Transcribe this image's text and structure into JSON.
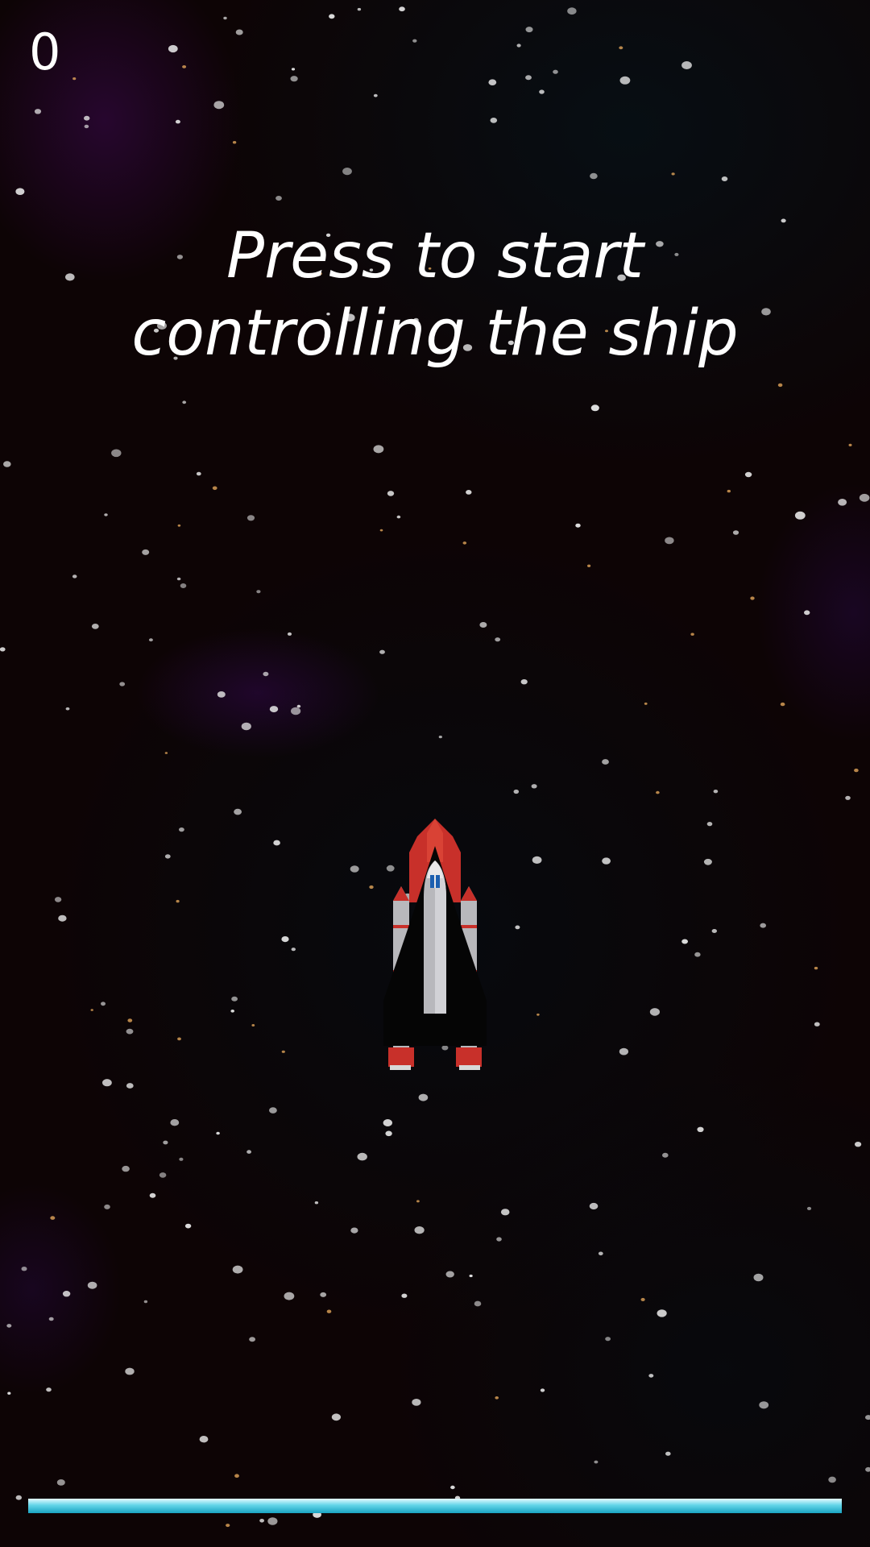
{
  "hud": {
    "score": "0"
  },
  "prompt": {
    "line1": "Press to start",
    "line2": "controlling the ship"
  },
  "progress": {
    "fill_fraction": 1.0,
    "color": "#2fb7d0"
  },
  "ship": {
    "icon": "space-shuttle-icon",
    "colors": {
      "body": "#b8b8bc",
      "accent": "#c8302a",
      "wings": "#050505",
      "window": "#1b5fb0"
    }
  },
  "background": {
    "colors": {
      "space": "#0d0405",
      "nebula": "#3c0850",
      "star": "#e8e8e8",
      "warm_star": "#f0b060"
    }
  }
}
